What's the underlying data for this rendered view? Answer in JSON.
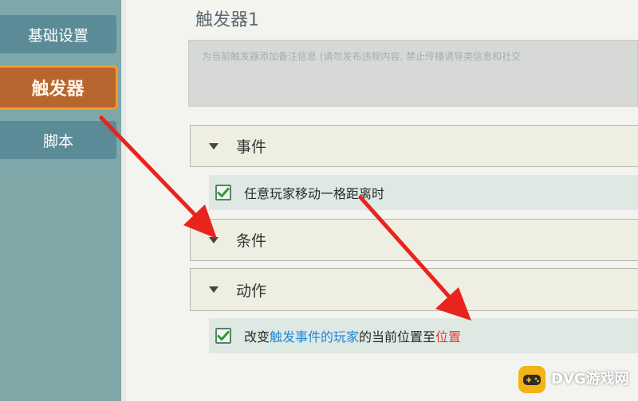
{
  "sidebar": {
    "items": [
      {
        "label": "基础设置"
      },
      {
        "label": "触发器"
      },
      {
        "label": "脚本"
      }
    ]
  },
  "trigger": {
    "title": "触发器1",
    "remark_placeholder": "为当前触发器添加备注信息 (请勿发布违规内容, 禁止传播诱导类信息和社交"
  },
  "sections": {
    "event": {
      "label": "事件",
      "items": [
        "任意玩家移动一格距离时"
      ]
    },
    "condition": {
      "label": "条件"
    },
    "action": {
      "label": "动作",
      "item_parts": {
        "p1": "改变",
        "p2": "触发事件的玩家",
        "p3": "的当前位置至",
        "p4": "位置"
      }
    }
  },
  "watermark": {
    "text": "DVG游戏网"
  },
  "colors": {
    "annotation_arrow": "#e8241c",
    "active_tab": "#b8662f",
    "link_blue": "#1e88d6",
    "link_red": "#e53935"
  }
}
